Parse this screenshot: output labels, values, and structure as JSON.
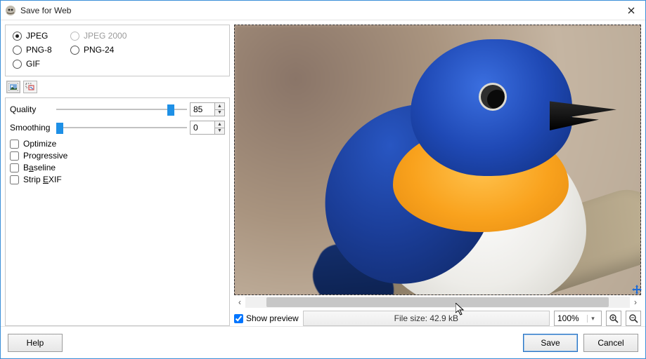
{
  "window": {
    "title": "Save for Web"
  },
  "formats": {
    "jpeg": "JPEG",
    "jpeg2000": "JPEG 2000",
    "png8": "PNG-8",
    "png24": "PNG-24",
    "gif": "GIF",
    "selected": "jpeg",
    "jpeg2000_enabled": false
  },
  "jpeg_opts": {
    "quality_label": "Quality",
    "quality_value": "85",
    "smoothing_label": "Smoothing",
    "smoothing_value": "0",
    "optimize": "Optimize",
    "progressive": "Progressive",
    "baseline_pre": "B",
    "baseline_ul": "a",
    "baseline_post": "seline",
    "stripexif_pre": "Strip ",
    "stripexif_ul": "E",
    "stripexif_post": "XIF"
  },
  "preview": {
    "show_label": "Show preview",
    "show_checked": true,
    "filesize_label": "File size: 42.9 kB",
    "zoom_value": "100%"
  },
  "buttons": {
    "help_ul": "H",
    "help_rest": "elp",
    "save_ul": "S",
    "save_rest": "ave",
    "cancel": "Cancel"
  }
}
